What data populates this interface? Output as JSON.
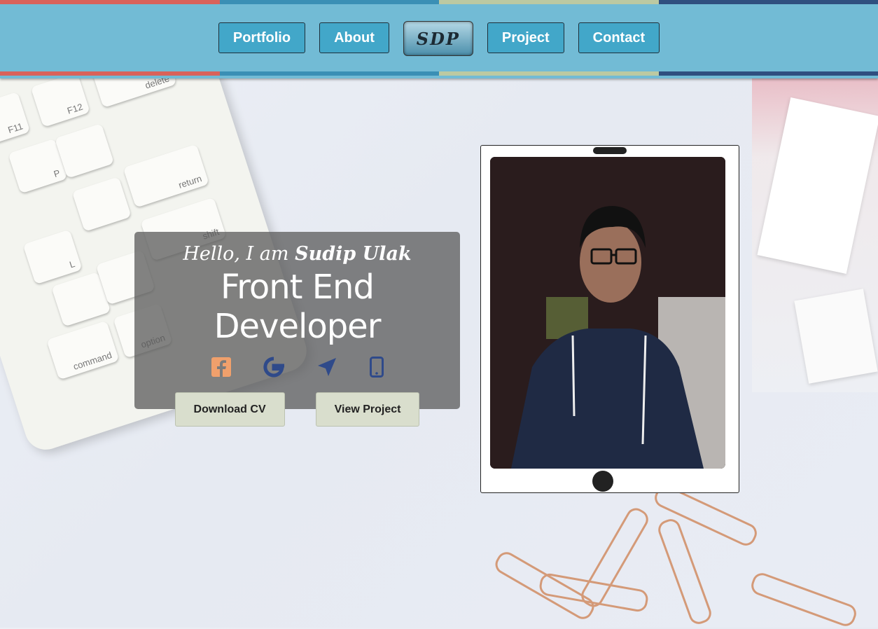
{
  "nav": {
    "items": [
      "Portfolio",
      "About",
      "Project",
      "Contact"
    ],
    "logo_text": "SDP"
  },
  "hero": {
    "greeting_prefix": "Hello, I am",
    "name": "Sudip Ulak",
    "role": "Front End Developer",
    "social_icons": [
      "facebook-icon",
      "google-icon",
      "location-arrow-icon",
      "mobile-phone-icon"
    ],
    "buttons": [
      "Download CV",
      "View Project"
    ]
  },
  "keyboard_keys": [
    "F11",
    "F12",
    "delete",
    "return",
    "shift",
    "option",
    "command",
    "P",
    "L"
  ],
  "colors": {
    "nav_bg": "#72bbd5",
    "nav_button": "#42a7c9",
    "stripe_red": "#d9625a",
    "stripe_blue": "#3a8fb5",
    "stripe_sage": "#bcc9a2",
    "stripe_navy": "#2f4f7f",
    "hero_button": "#d9decd",
    "icon_facebook": "#f0a06c",
    "icon_other": "#2f4a8a"
  }
}
